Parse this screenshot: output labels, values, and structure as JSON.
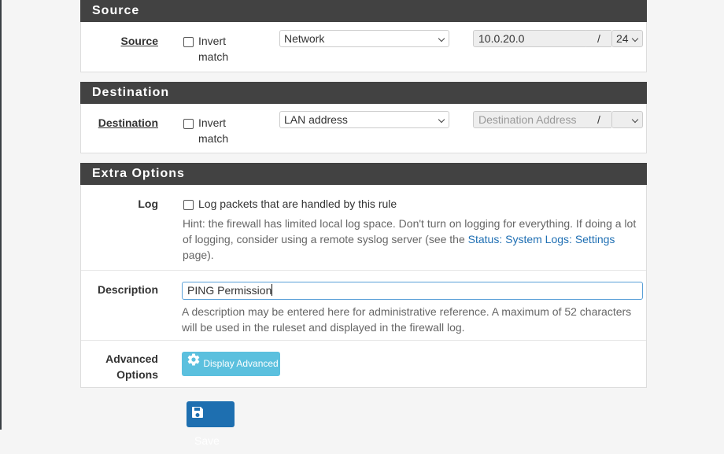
{
  "source_section": {
    "heading": "Source",
    "label": "Source",
    "invert_line1": "Invert",
    "invert_line2": "match",
    "type_value": "Network",
    "address_value": "10.0.20.0",
    "slash": "/",
    "mask_value": "24"
  },
  "destination_section": {
    "heading": "Destination",
    "label": "Destination",
    "invert_line1": "Invert",
    "invert_line2": "match",
    "type_value": "LAN address",
    "address_placeholder": "Destination Address",
    "slash": "/",
    "mask_value": ""
  },
  "extra_options": {
    "heading": "Extra Options",
    "log": {
      "label": "Log",
      "checkbox_text": "Log packets that are handled by this rule",
      "hint_line1": "Hint: the firewall has limited local log space. Don't turn on logging for everything. If doing a lot",
      "hint_line2_before": "of logging, consider using a remote syslog server (see the ",
      "hint_link": "Status: System Logs: Settings",
      "hint_line3": "page)."
    },
    "description": {
      "label": "Description",
      "value": "PING Permission",
      "help_line1": "A description may be entered here for administrative reference. A maximum of 52 characters",
      "help_line2": "will be used in the ruleset and displayed in the firewall log."
    },
    "advanced": {
      "label_line1": "Advanced",
      "label_line2": "Options",
      "button_label": "Display Advanced",
      "icon": "gear-icon"
    }
  },
  "save_button": {
    "label": "Save",
    "icon": "save-icon"
  },
  "colors": {
    "heading_bg": "#424242",
    "info_button": "#5bc0de",
    "primary_button": "#1e6fb0",
    "link": "#1f6fb3"
  }
}
